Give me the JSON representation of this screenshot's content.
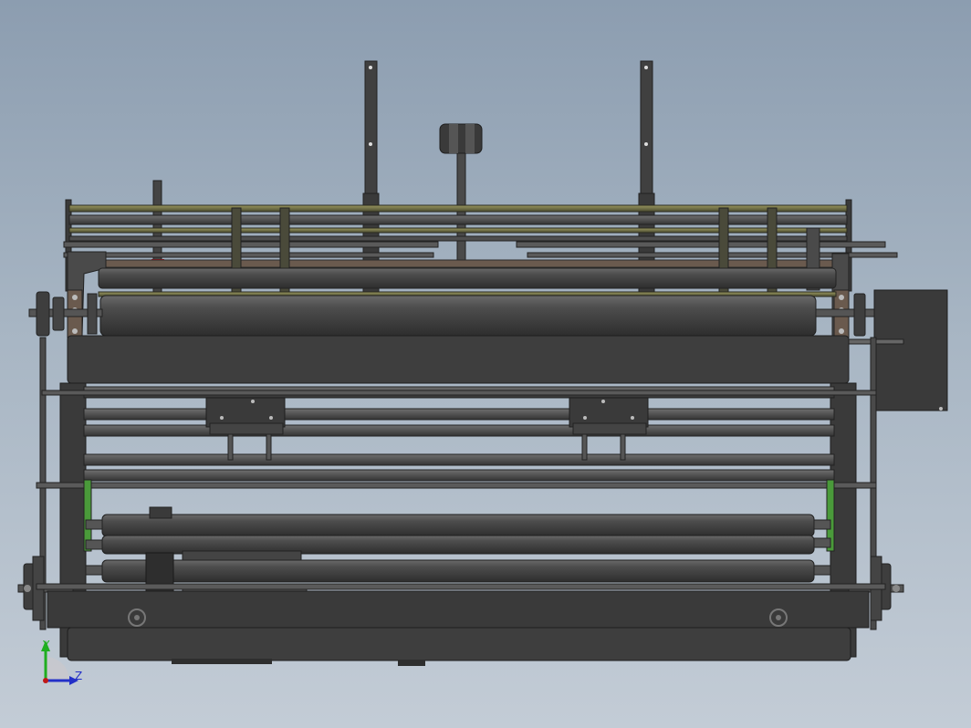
{
  "viewport": {
    "background_top": "#8c9db0",
    "background_bottom": "#c3ccd6"
  },
  "triad": {
    "y_label": "Y",
    "z_label": "Z",
    "y_color": "#1fae1f",
    "z_color": "#2330c8"
  },
  "model": {
    "body_color": "#3e3e3e",
    "roller_color": "#4a4a4a",
    "accent_olive": "#8c8a50",
    "accent_green": "#4a9a3a",
    "accent_red": "#b0121a",
    "accent_tan": "#6a5a4e"
  }
}
